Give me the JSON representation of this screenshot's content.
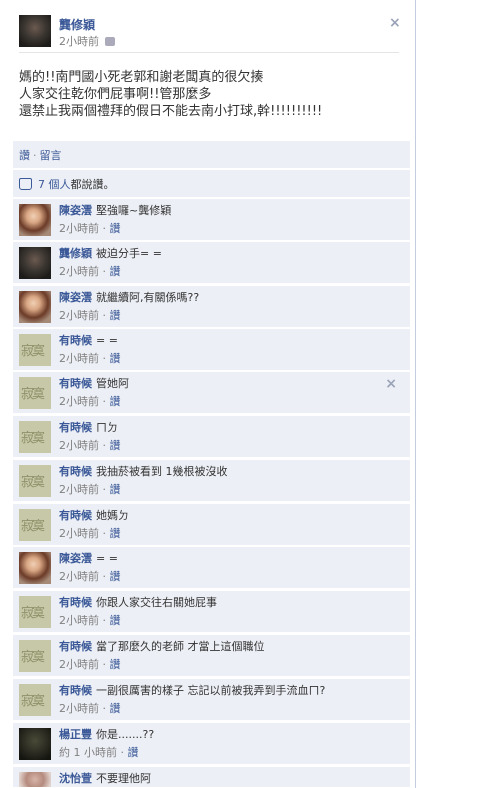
{
  "post": {
    "author": "龔修穎",
    "time": "2小時前",
    "close": "×",
    "body": [
      "媽的!!南門國小死老郭和謝老闆真的很欠揍",
      "人家交往乾你們屁事啊!!管那麼多",
      "還禁止我兩個禮拜的假日不能去南小打球,幹!!!!!!!!!!"
    ]
  },
  "actions": {
    "like": "讚",
    "separator": "·",
    "comment": "留言"
  },
  "likes": {
    "count": "7 個人",
    "suffix": "都說讚。"
  },
  "comments": [
    {
      "name": "陳姿澐",
      "text": "堅強囉~龔修穎",
      "time": "2小時前",
      "like": "讚",
      "avatar": "girl-photo"
    },
    {
      "name": "龔修穎",
      "text": "被迫分手= =",
      "time": "2小時前",
      "like": "讚",
      "avatar": "dark-photo"
    },
    {
      "name": "陳姿澐",
      "text": "就繼續阿,有關係嗎??",
      "time": "2小時前",
      "like": "讚",
      "avatar": "girl-photo"
    },
    {
      "name": "有時候",
      "text": "= =",
      "time": "2小時前",
      "like": "讚",
      "avatar": "text-photo"
    },
    {
      "name": "有時候",
      "text": "管她阿",
      "time": "2小時前",
      "like": "讚",
      "avatar": "text-photo",
      "close": "×"
    },
    {
      "name": "有時候",
      "text": "ㄇㄉ",
      "time": "2小時前",
      "like": "讚",
      "avatar": "text-photo"
    },
    {
      "name": "有時候",
      "text": "我抽菸被看到 1幾根被沒收",
      "time": "2小時前",
      "like": "讚",
      "avatar": "text-photo"
    },
    {
      "name": "有時候",
      "text": "她媽ㄉ",
      "time": "2小時前",
      "like": "讚",
      "avatar": "text-photo"
    },
    {
      "name": "陳姿澐",
      "text": "= =",
      "time": "2小時前",
      "like": "讚",
      "avatar": "girl-photo"
    },
    {
      "name": "有時候",
      "text": "你跟人家交往右關她屁事",
      "time": "2小時前",
      "like": "讚",
      "avatar": "text-photo"
    },
    {
      "name": "有時候",
      "text": "當了那麼久的老師 才當上這個職位",
      "time": "2小時前",
      "like": "讚",
      "avatar": "text-photo"
    },
    {
      "name": "有時候",
      "text": "一副很厲害的樣子 忘記以前被我弄到手流血ㄇ?",
      "time": "2小時前",
      "like": "讚",
      "avatar": "text-photo"
    },
    {
      "name": "楊正豐",
      "text": "你是.......??",
      "time": "約 1 小時前",
      "like": "讚",
      "avatar": "boy-photo"
    },
    {
      "name": "沈怡萱",
      "text": "不要理他阿",
      "time": "",
      "like": "",
      "avatar": "pink-photo"
    }
  ]
}
